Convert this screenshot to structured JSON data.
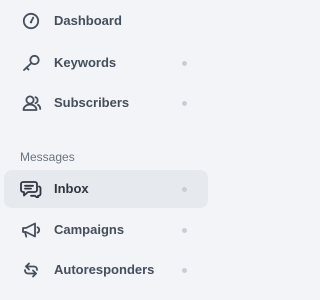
{
  "sidebar": {
    "items": [
      {
        "label": "Dashboard",
        "icon": "dashboard-gauge-icon",
        "dot": false
      },
      {
        "label": "Keywords",
        "icon": "key-icon",
        "dot": true
      },
      {
        "label": "Subscribers",
        "icon": "users-icon",
        "dot": true
      }
    ],
    "messages_section": {
      "title": "Messages",
      "items": [
        {
          "label": "Inbox",
          "icon": "chat-bubbles-icon",
          "dot": true,
          "active": true
        },
        {
          "label": "Campaigns",
          "icon": "megaphone-icon",
          "dot": true
        },
        {
          "label": "Autoresponders",
          "icon": "reply-arrows-icon",
          "dot": true
        }
      ]
    }
  },
  "colors": {
    "background": "#f2f4f7",
    "active_background": "#e6e9ee",
    "label": "#454e5c",
    "section_title": "#6b7380",
    "dot": "#c9ced6"
  }
}
